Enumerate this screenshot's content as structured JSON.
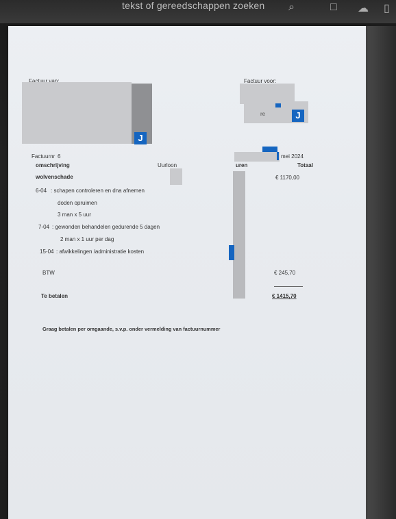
{
  "topbar": {
    "search_text": "tekst of gereedschappen zoeken",
    "search_icon": "search-icon",
    "icons": [
      "inbox-icon",
      "cloud-upload-icon"
    ]
  },
  "invoice": {
    "from_label": "Factuur van:",
    "to_label": "Factuur voor:",
    "to_partial": "re",
    "badge_letter": "J",
    "invoice_number_label": "Factuurnr",
    "invoice_number": "6",
    "date": "mei 2024",
    "headers": {
      "description": "omschrijving",
      "rate": "Uurloon",
      "hours": "uren",
      "total": "Totaal"
    },
    "project": "wolvenschade",
    "project_total": "€ 1170,00",
    "lines": [
      {
        "date": "6-04",
        "text": ": schapen controleren en dna afnemen"
      },
      {
        "date": "",
        "text": "doden opruimen"
      },
      {
        "date": "",
        "text": "3 man x 5 uur"
      },
      {
        "date": "7-04",
        "text": ": gewonden behandelen gedurende 5 dagen"
      },
      {
        "date": "",
        "text": "2 man x 1 uur per dag"
      },
      {
        "date": "15-04",
        "text": ": afwikkelingen /administratie kosten"
      }
    ],
    "vat_label": "BTW",
    "vat_amount": "€ 245,70",
    "total_label": "Te betalen",
    "total_amount": "€ 1415,70",
    "note": "Graag betalen per omgaande, s.v.p. onder vermelding van factuurnummer"
  },
  "colors": {
    "accent": "#1565c0",
    "paper": "#eceff3",
    "redaction": "#c9cacd"
  }
}
